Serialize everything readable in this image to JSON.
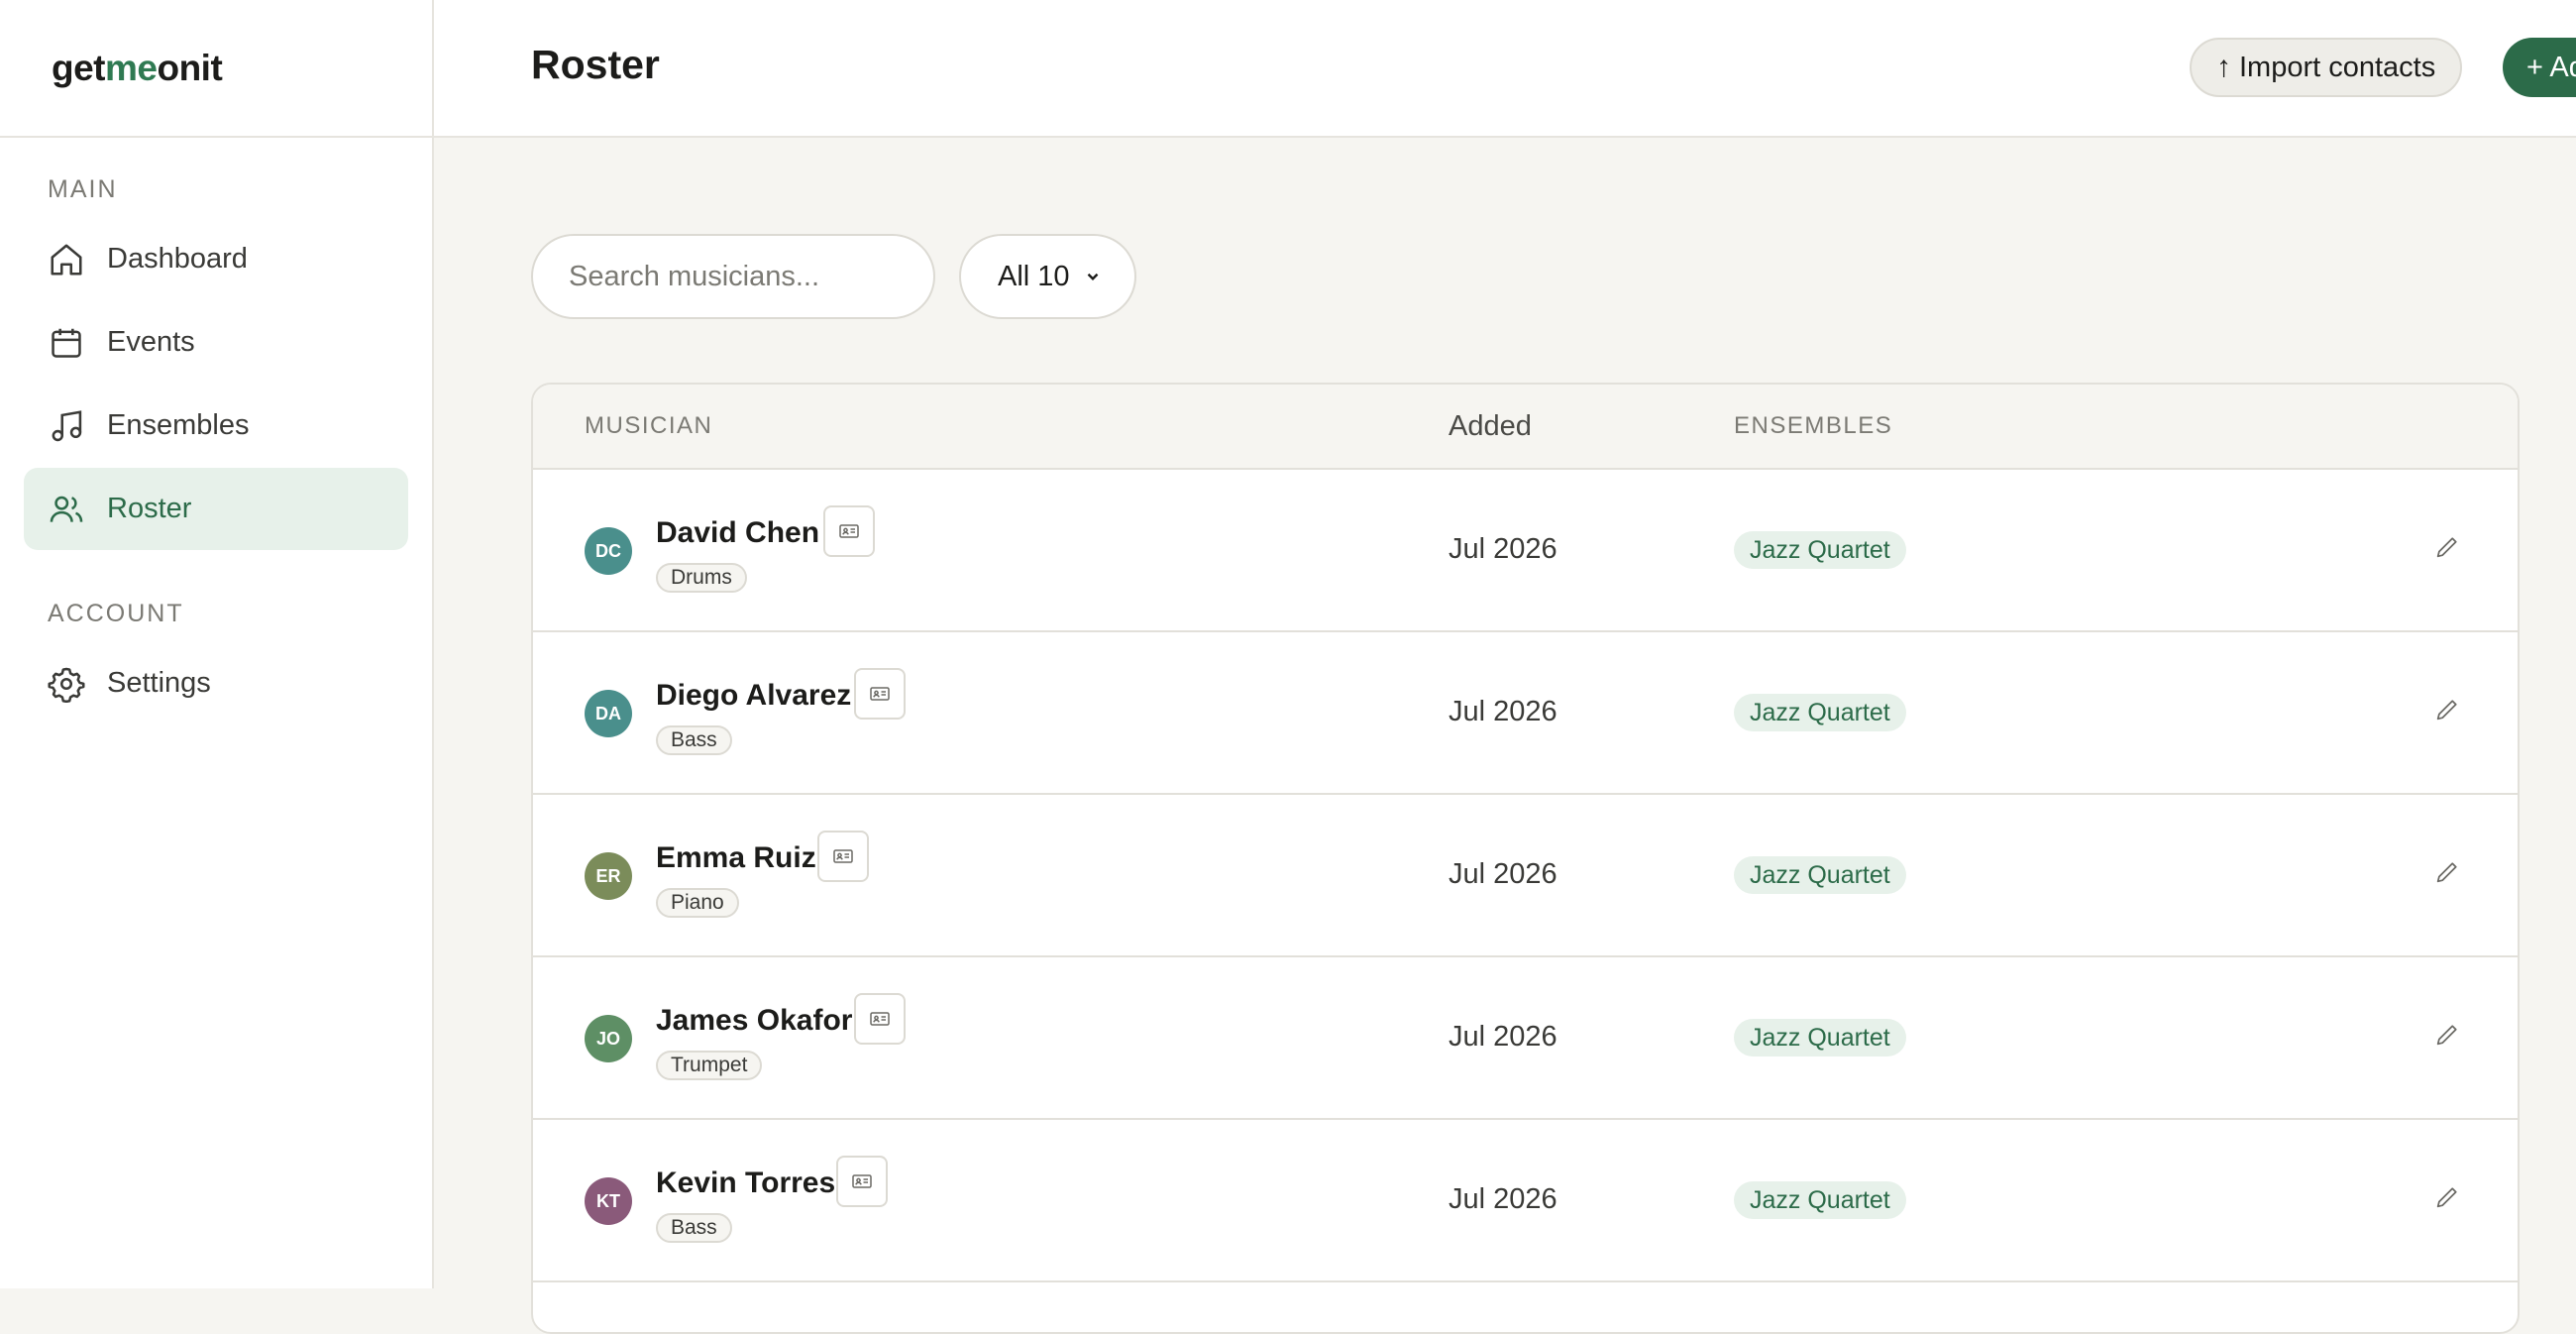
{
  "brand": {
    "part1": "get",
    "part2": "me",
    "part3": "onit"
  },
  "sidebar": {
    "main_title": "MAIN",
    "account_title": "ACCOUNT",
    "items": [
      {
        "label": "Dashboard",
        "icon": "home-icon"
      },
      {
        "label": "Events",
        "icon": "calendar-icon"
      },
      {
        "label": "Ensembles",
        "icon": "music-note-icon"
      },
      {
        "label": "Roster",
        "icon": "users-icon",
        "active": true
      },
      {
        "label": "Settings",
        "icon": "gear-icon"
      }
    ]
  },
  "header": {
    "title": "Roster",
    "import_label": "Import contacts",
    "import_icon": "arrow-up-icon",
    "add_label": "+ Add"
  },
  "toolbar": {
    "search_placeholder": "Search musicians...",
    "filter_label": "All 10"
  },
  "table": {
    "columns": {
      "musician": "MUSICIAN",
      "added": "Added",
      "ensembles": "ENSEMBLES"
    },
    "rows": [
      {
        "initials": "DC",
        "name": "David Chen",
        "instrument": "Drums",
        "added": "Jul 2026",
        "ensemble": "Jazz Quartet",
        "avatar_color": "#4a8f8c"
      },
      {
        "initials": "DA",
        "name": "Diego Alvarez",
        "instrument": "Bass",
        "added": "Jul 2026",
        "ensemble": "Jazz Quartet",
        "avatar_color": "#4a8f8c"
      },
      {
        "initials": "ER",
        "name": "Emma Ruiz",
        "instrument": "Piano",
        "added": "Jul 2026",
        "ensemble": "Jazz Quartet",
        "avatar_color": "#7b8c5a"
      },
      {
        "initials": "JO",
        "name": "James Okafor",
        "instrument": "Trumpet",
        "added": "Jul 2026",
        "ensemble": "Jazz Quartet",
        "avatar_color": "#5e8f65"
      },
      {
        "initials": "KT",
        "name": "Kevin Torres",
        "instrument": "Bass",
        "added": "Jul 2026",
        "ensemble": "Jazz Quartet",
        "avatar_color": "#8a5a7a"
      }
    ]
  },
  "colors": {
    "accent": "#2c6b49",
    "accent_bg": "#e7f1ea"
  }
}
